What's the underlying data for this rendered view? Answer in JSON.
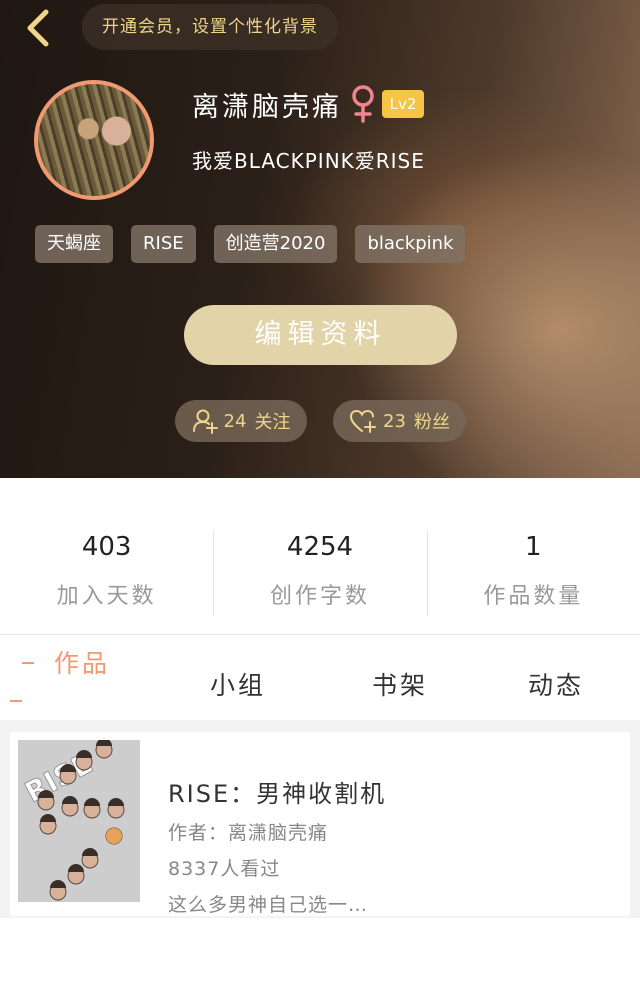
{
  "header": {
    "vip_banner": "开通会员，设置个性化背景",
    "nickname": "离潇脑壳痛",
    "gender_symbol": "♀",
    "level": "Lv2",
    "signature": "我爱BLACKPINK爱RISE",
    "tags": [
      "天蝎座",
      "RISE",
      "创造营2020",
      "blackpink"
    ],
    "edit_label": "编辑资料",
    "following": {
      "count": "24",
      "label": "关注"
    },
    "fans": {
      "count": "23",
      "label": "粉丝"
    }
  },
  "stats": [
    {
      "value": "403",
      "label": "加入天数"
    },
    {
      "value": "4254",
      "label": "创作字数"
    },
    {
      "value": "1",
      "label": "作品数量"
    }
  ],
  "tabs": [
    "作品",
    "小组",
    "书架",
    "动态"
  ],
  "works": [
    {
      "title": "RISE：男神收割机",
      "author": "作者：离潇脑壳痛",
      "views": "8337人看过",
      "description": "这么多男神自己选一…",
      "cover_text": "RISE"
    }
  ],
  "colors": {
    "accent": "#f19a72",
    "gold": "#efd58a",
    "level_badge": "#f6c545",
    "edit_button": "#e2d3a8"
  }
}
